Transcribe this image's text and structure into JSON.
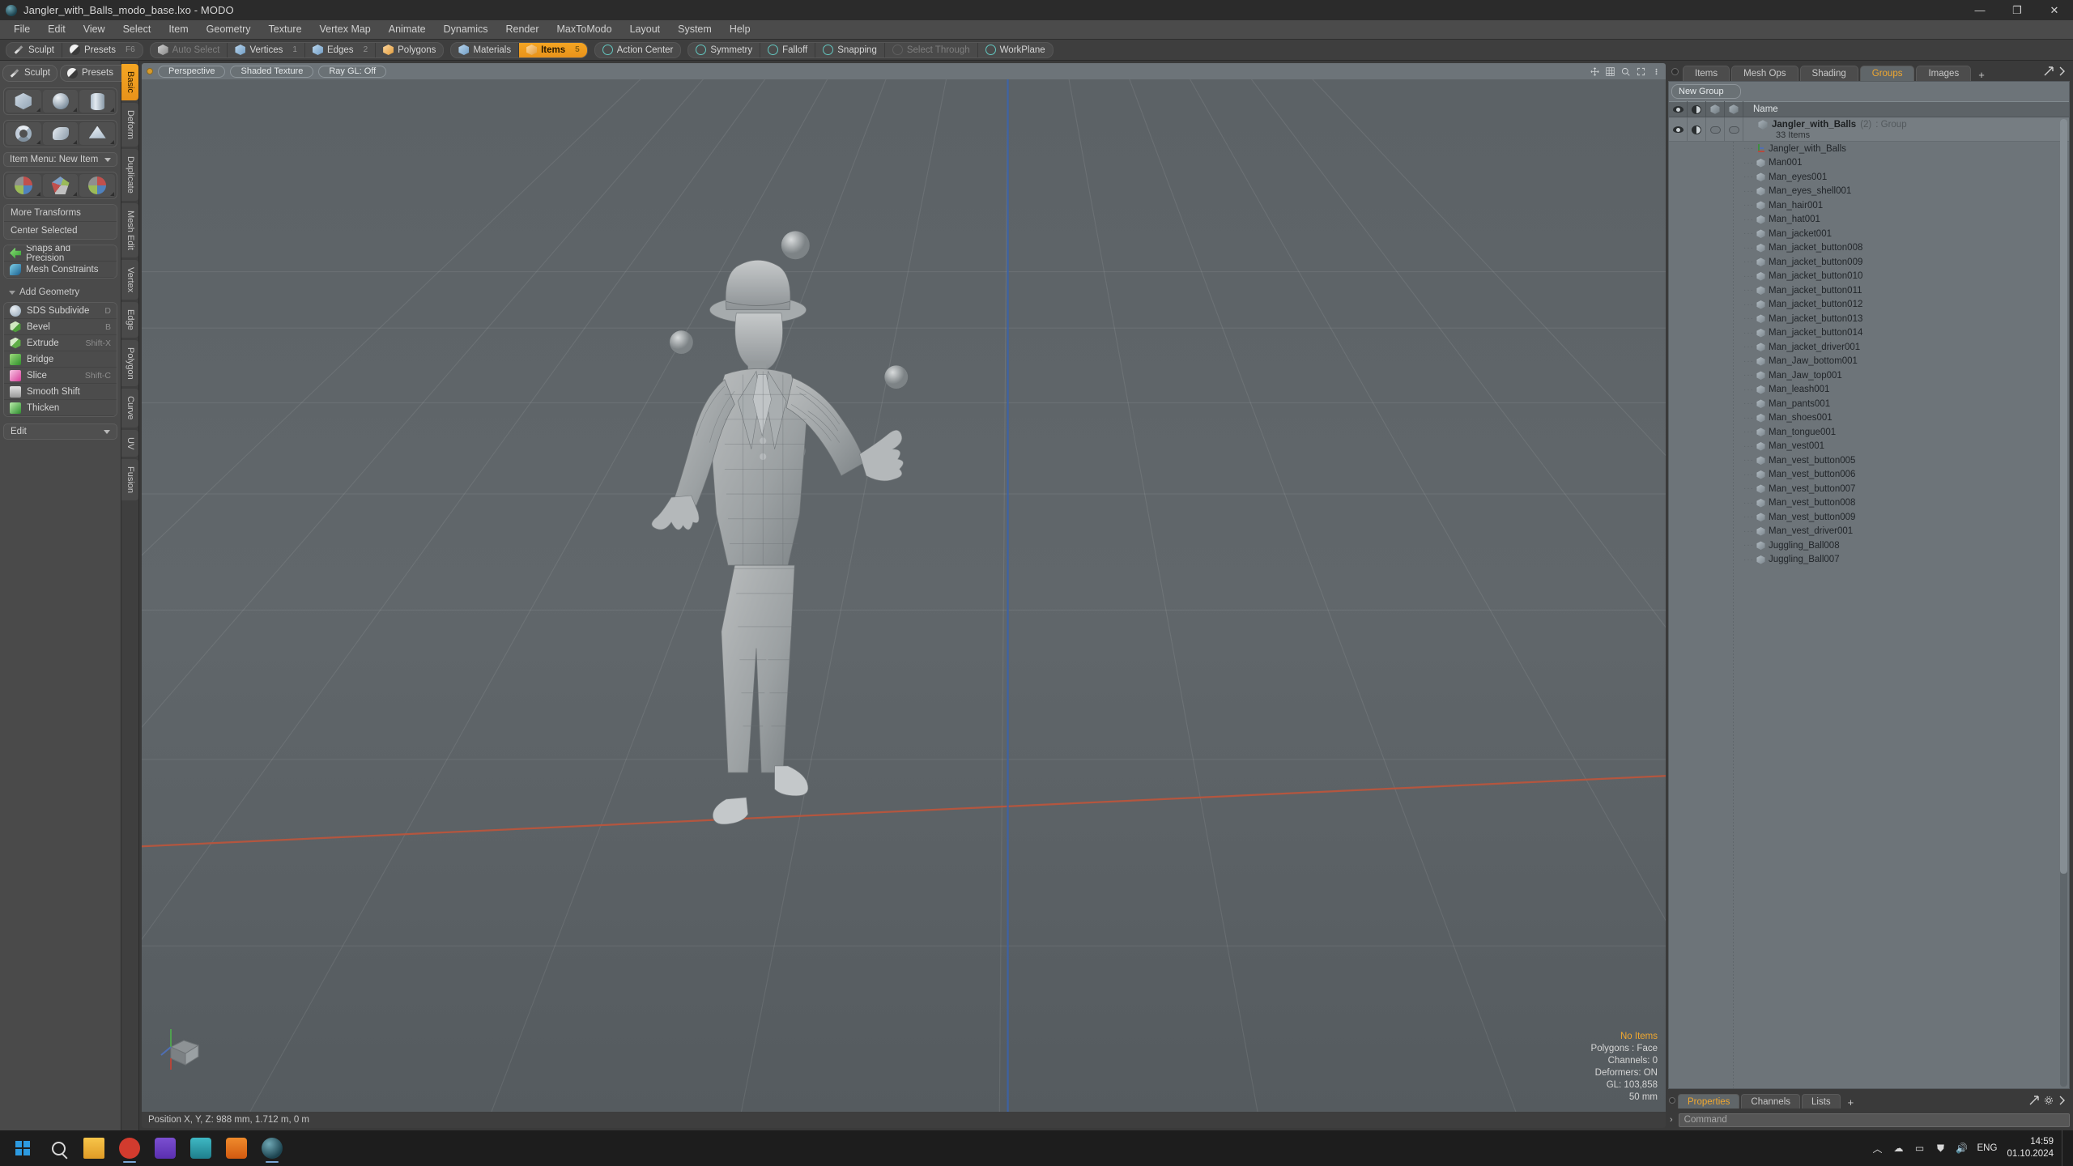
{
  "titlebar": {
    "title": "Jangler_with_Balls_modo_base.lxo - MODO",
    "icon": "modo-app-icon",
    "minimize": "—",
    "maximize": "❐",
    "close": "✕"
  },
  "menubar": {
    "items": [
      "File",
      "Edit",
      "View",
      "Select",
      "Item",
      "Geometry",
      "Texture",
      "Vertex Map",
      "Animate",
      "Dynamics",
      "Render",
      "MaxToModo",
      "Layout",
      "System",
      "Help"
    ]
  },
  "modebar": {
    "left_group": [
      {
        "label": "Sculpt",
        "icon": "pencil-icon",
        "key": "",
        "state": "normal"
      },
      {
        "label": "Presets",
        "icon": "sphere-icon",
        "key": "F6",
        "state": "normal"
      }
    ],
    "select_group": [
      {
        "label": "Auto Select",
        "icon": "cube-grey-icon",
        "key": "",
        "state": "dim"
      },
      {
        "label": "Vertices",
        "icon": "cube-blue-icon",
        "key": "1",
        "state": "normal"
      },
      {
        "label": "Edges",
        "icon": "cube-blue-icon",
        "key": "2",
        "state": "normal"
      },
      {
        "label": "Polygons",
        "icon": "cube-orange-icon",
        "key": "",
        "state": "normal"
      }
    ],
    "items_group": [
      {
        "label": "Materials",
        "icon": "cube-blue-icon",
        "key": "",
        "state": "normal"
      },
      {
        "label": "Items",
        "icon": "cube-orange-icon",
        "key": "5",
        "state": "active"
      }
    ],
    "right_group": [
      {
        "label": "Action Center",
        "icon": "crosshair-icon",
        "key": "",
        "state": "normal"
      },
      {
        "label": "Symmetry",
        "icon": "symmetry-icon",
        "key": "",
        "state": "normal"
      },
      {
        "label": "Falloff",
        "icon": "falloff-icon",
        "key": "",
        "state": "normal"
      },
      {
        "label": "Snapping",
        "icon": "snapping-icon",
        "key": "",
        "state": "normal"
      },
      {
        "label": "Select Through",
        "icon": "select-through-icon",
        "key": "",
        "state": "dim"
      },
      {
        "label": "WorkPlane",
        "icon": "workplane-icon",
        "key": "",
        "state": "normal"
      }
    ]
  },
  "left_panel": {
    "top": [
      {
        "label": "Sculpt",
        "icon": "pencil-icon",
        "key": ""
      },
      {
        "label": "Presets",
        "icon": "halfball-icon",
        "key": "F6"
      }
    ],
    "primitive_rows": [
      [
        {
          "name": "cube-primitive",
          "icon": "box-shape"
        },
        {
          "name": "sphere-primitive",
          "icon": "sphere-shape"
        },
        {
          "name": "cylinder-primitive",
          "icon": "cylinder-shape"
        }
      ],
      [
        {
          "name": "torus-primitive",
          "icon": "torus-shape"
        },
        {
          "name": "tube-primitive",
          "icon": "tube-shape"
        },
        {
          "name": "polygon-primitive",
          "icon": "polygon-shape"
        }
      ]
    ],
    "item_menu": "Item Menu: New Item",
    "transform_icons": [
      {
        "name": "move-tool",
        "icon": "move-axis-icon"
      },
      {
        "name": "rotate-tool",
        "icon": "rotate-axis-icon"
      },
      {
        "name": "scale-tool",
        "icon": "scale-axis-icon"
      }
    ],
    "transform_buttons": [
      "More Transforms",
      "Center Selected"
    ],
    "constraint_buttons": [
      {
        "label": "Snaps and Precision",
        "icon": "snap-arrow-icon"
      },
      {
        "label": "Mesh Constraints",
        "icon": "mesh-constraint-icon"
      }
    ],
    "add_geometry_header": "Add Geometry",
    "geometry_tools": [
      {
        "label": "SDS Subdivide",
        "key": "D",
        "icon": "sds-icon"
      },
      {
        "label": "Bevel",
        "key": "B",
        "icon": "bevel-icon"
      },
      {
        "label": "Extrude",
        "key": "Shift-X",
        "icon": "extrude-icon"
      },
      {
        "label": "Bridge",
        "key": "",
        "icon": "bridge-icon"
      },
      {
        "label": "Slice",
        "key": "Shift-C",
        "icon": "slice-icon"
      },
      {
        "label": "Smooth Shift",
        "key": "",
        "icon": "smooth-shift-icon"
      },
      {
        "label": "Thicken",
        "key": "",
        "icon": "thicken-icon"
      }
    ],
    "edit_select": "Edit",
    "vertical_tabs": [
      "Basic",
      "Deform",
      "Duplicate",
      "Mesh Edit",
      "Vertex",
      "Edge",
      "Polygon",
      "Curve",
      "UV",
      "Fusion"
    ],
    "vertical_tab_active": "Basic"
  },
  "viewport": {
    "header_pills": [
      "Perspective",
      "Shaded Texture",
      "Ray GL: Off"
    ],
    "info": {
      "selection": "No Items",
      "polygons": "Polygons : Face",
      "channels": "Channels: 0",
      "deformers": "Deformers: ON",
      "gl": "GL: 103,858",
      "scale": "50 mm"
    },
    "footer": "Position X, Y, Z:   988 mm, 1.712 m, 0 m"
  },
  "right_panel": {
    "tabs": [
      {
        "label": "Items",
        "active": false
      },
      {
        "label": "Mesh Ops",
        "active": false
      },
      {
        "label": "Shading",
        "active": false
      },
      {
        "label": "Groups",
        "active": true
      },
      {
        "label": "Images",
        "active": false
      }
    ],
    "tab_plus": "+",
    "new_group_button": "New Group",
    "columns": [
      "visible-col",
      "shading-col",
      "render-col",
      "lock-col",
      "Name"
    ],
    "name_column": "Name",
    "group": {
      "name": "Jangler_with_Balls",
      "count": "(2)",
      "type": ": Group",
      "subtitle": "33 Items"
    },
    "items": [
      {
        "name": "Jangler_with_Balls",
        "icon": "locator-icon"
      },
      {
        "name": "Man001",
        "icon": "mesh-icon"
      },
      {
        "name": "Man_eyes001",
        "icon": "mesh-icon"
      },
      {
        "name": "Man_eyes_shell001",
        "icon": "mesh-icon"
      },
      {
        "name": "Man_hair001",
        "icon": "mesh-icon"
      },
      {
        "name": "Man_hat001",
        "icon": "mesh-icon"
      },
      {
        "name": "Man_jacket001",
        "icon": "mesh-icon"
      },
      {
        "name": "Man_jacket_button008",
        "icon": "mesh-icon"
      },
      {
        "name": "Man_jacket_button009",
        "icon": "mesh-icon"
      },
      {
        "name": "Man_jacket_button010",
        "icon": "mesh-icon"
      },
      {
        "name": "Man_jacket_button011",
        "icon": "mesh-icon"
      },
      {
        "name": "Man_jacket_button012",
        "icon": "mesh-icon"
      },
      {
        "name": "Man_jacket_button013",
        "icon": "mesh-icon"
      },
      {
        "name": "Man_jacket_button014",
        "icon": "mesh-icon"
      },
      {
        "name": "Man_jacket_driver001",
        "icon": "mesh-icon"
      },
      {
        "name": "Man_Jaw_bottom001",
        "icon": "mesh-icon"
      },
      {
        "name": "Man_Jaw_top001",
        "icon": "mesh-icon"
      },
      {
        "name": "Man_leash001",
        "icon": "mesh-icon"
      },
      {
        "name": "Man_pants001",
        "icon": "mesh-icon"
      },
      {
        "name": "Man_shoes001",
        "icon": "mesh-icon"
      },
      {
        "name": "Man_tongue001",
        "icon": "mesh-icon"
      },
      {
        "name": "Man_vest001",
        "icon": "mesh-icon"
      },
      {
        "name": "Man_vest_button005",
        "icon": "mesh-icon"
      },
      {
        "name": "Man_vest_button006",
        "icon": "mesh-icon"
      },
      {
        "name": "Man_vest_button007",
        "icon": "mesh-icon"
      },
      {
        "name": "Man_vest_button008",
        "icon": "mesh-icon"
      },
      {
        "name": "Man_vest_button009",
        "icon": "mesh-icon"
      },
      {
        "name": "Man_vest_driver001",
        "icon": "mesh-icon"
      },
      {
        "name": "Juggling_Ball008",
        "icon": "mesh-icon"
      },
      {
        "name": "Juggling_Ball007",
        "icon": "mesh-icon"
      }
    ],
    "bottom_tabs": [
      {
        "label": "Properties",
        "active": true
      },
      {
        "label": "Channels",
        "active": false
      },
      {
        "label": "Lists",
        "active": false
      }
    ],
    "bottom_tab_plus": "+",
    "command_placeholder": "Command"
  },
  "taskbar": {
    "start": "windows-logo",
    "search": "search-icon",
    "apps": [
      "file-explorer-icon",
      "record-icon",
      "purple-app-icon",
      "teal-app-icon",
      "orange-app-icon",
      "modo-icon"
    ],
    "tray": [
      "chevron-up-icon",
      "onedrive-icon",
      "network-icon",
      "shield-icon",
      "volume-icon"
    ],
    "language": "ENG",
    "time": "14:59",
    "date": "01.10.2024"
  },
  "colors": {
    "accent": "#f0a830",
    "panel": "#4a4a4a",
    "viewport": "#60666a",
    "list": "#6d7479"
  }
}
